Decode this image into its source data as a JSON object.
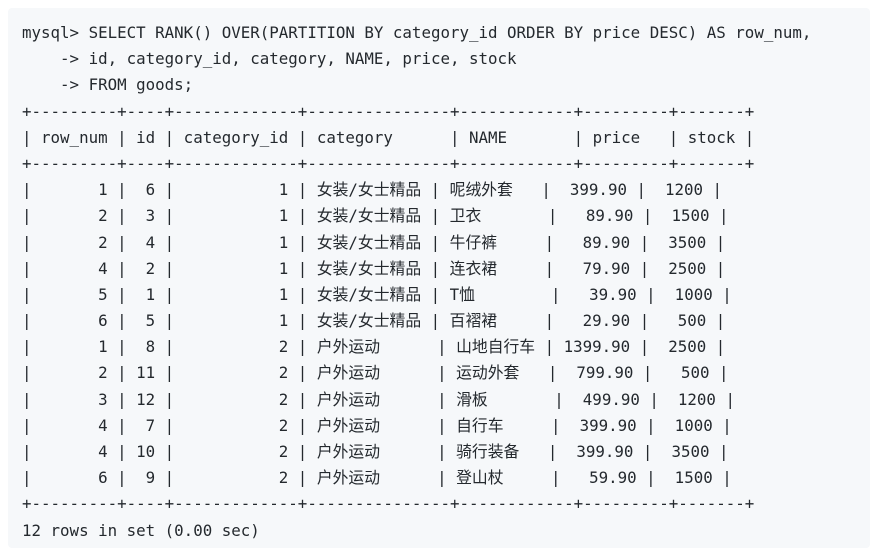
{
  "prompt": {
    "mysql": "mysql> ",
    "continuation": "    -> "
  },
  "query": {
    "line1": "SELECT RANK() OVER(PARTITION BY category_id ORDER BY price DESC) AS row_num,",
    "line2": "id, category_id, category, NAME, price, stock",
    "line3": "FROM goods;"
  },
  "table": {
    "border": "+---------+----+-------------+---------------+------------+---------+-------+",
    "header": "| row_num | id | category_id | category      | NAME       | price   | stock |",
    "rows": [
      "|       1 |  6 |           1 | 女装/女士精品 | 呢绒外套   |  399.90 |  1200 |",
      "|       2 |  3 |           1 | 女装/女士精品 | 卫衣       |   89.90 |  1500 |",
      "|       2 |  4 |           1 | 女装/女士精品 | 牛仔裤     |   89.90 |  3500 |",
      "|       4 |  2 |           1 | 女装/女士精品 | 连衣裙     |   79.90 |  2500 |",
      "|       5 |  1 |           1 | 女装/女士精品 | T恤        |   39.90 |  1000 |",
      "|       6 |  5 |           1 | 女装/女士精品 | 百褶裙     |   29.90 |   500 |",
      "|       1 |  8 |           2 | 户外运动      | 山地自行车 | 1399.90 |  2500 |",
      "|       2 | 11 |           2 | 户外运动      | 运动外套   |  799.90 |   500 |",
      "|       3 | 12 |           2 | 户外运动      | 滑板       |  499.90 |  1200 |",
      "|       4 |  7 |           2 | 户外运动      | 自行车     |  399.90 |  1000 |",
      "|       4 | 10 |           2 | 户外运动      | 骑行装备   |  399.90 |  3500 |",
      "|       6 |  9 |           2 | 户外运动      | 登山杖     |   59.90 |  1500 |"
    ]
  },
  "footer": "12 rows in set (0.00 sec)"
}
